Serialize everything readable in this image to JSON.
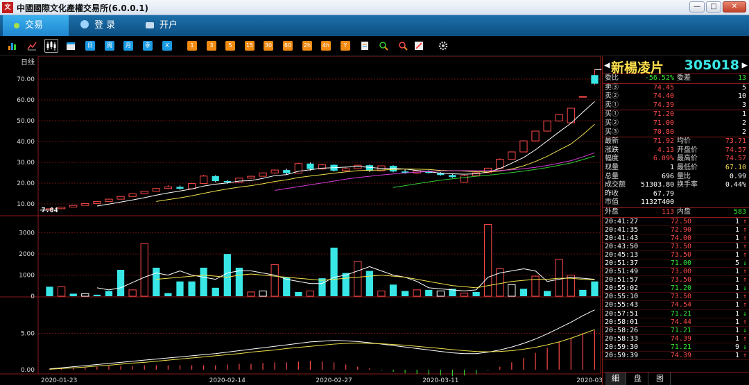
{
  "window": {
    "title": "中國國際文化產權交易所(6.0.0.1)",
    "logo_text": "文"
  },
  "nav": {
    "trade": "交易",
    "login": "登 录",
    "open_account": "开户"
  },
  "toolbar": {
    "icons": [
      "bar-chart-icon",
      "line-chart-icon",
      "kline-icon",
      "calendar-icon"
    ],
    "periods": [
      "日",
      "周",
      "月",
      "季",
      "X"
    ],
    "minutes": [
      "1",
      "3",
      "5",
      "15",
      "30",
      "60",
      "2h",
      "4h",
      "Y"
    ],
    "tools": [
      "report-icon",
      "zoom-in-icon",
      "zoom-out-icon",
      "draw-icon",
      "settings-icon"
    ]
  },
  "colors": {
    "up": "#ff4a4a",
    "down": "#38e6e6",
    "ma5": "#ffffff",
    "ma10": "#f0e24a",
    "ma20": "#d63cd6",
    "ma30": "#33cc33",
    "grid": "#8c1a1a",
    "axis_text": "#dddddd"
  },
  "chart_data": [
    {
      "type": "candlestick",
      "title": "日线",
      "dates": [
        "2020-01-23",
        "2020-01-24",
        "2020-01-28",
        "2020-01-29",
        "2020-01-30",
        "2020-01-31",
        "2020-02-03",
        "2020-02-04",
        "2020-02-05",
        "2020-02-06",
        "2020-02-07",
        "2020-02-10",
        "2020-02-11",
        "2020-02-12",
        "2020-02-13",
        "2020-02-14",
        "2020-02-17",
        "2020-02-18",
        "2020-02-19",
        "2020-02-20",
        "2020-02-21",
        "2020-02-24",
        "2020-02-25",
        "2020-02-26",
        "2020-02-27",
        "2020-02-28",
        "2020-03-02",
        "2020-03-03",
        "2020-03-04",
        "2020-03-05",
        "2020-03-06",
        "2020-03-09",
        "2020-03-10",
        "2020-03-11",
        "2020-03-12",
        "2020-03-13",
        "2020-03-16",
        "2020-03-17",
        "2020-03-18",
        "2020-03-19",
        "2020-03-20",
        "2020-03-23",
        "2020-03-24",
        "2020-03-25",
        "2020-03-26",
        "2020-03-27",
        "2020-03-30"
      ],
      "x_labels": [
        "2020-01-23",
        "2020-02-14",
        "2020-02-27",
        "2020-03-11",
        "2020-03-30"
      ],
      "ohlc": [
        [
          7.04,
          7.8,
          7.0,
          7.7
        ],
        [
          7.7,
          8.6,
          7.6,
          8.5
        ],
        [
          8.5,
          9.4,
          8.4,
          9.3
        ],
        [
          9.3,
          10.4,
          9.2,
          10.2
        ],
        [
          10.2,
          11.3,
          10.1,
          11.2
        ],
        [
          11.2,
          12.4,
          11.1,
          12.3
        ],
        [
          12.3,
          13.7,
          12.2,
          13.6
        ],
        [
          13.6,
          15.0,
          13.5,
          14.9
        ],
        [
          14.9,
          16.2,
          14.8,
          16.1
        ],
        [
          16.1,
          17.6,
          16.0,
          17.4
        ],
        [
          17.4,
          19.0,
          17.3,
          18.2
        ],
        [
          18.2,
          18.9,
          16.8,
          17.3
        ],
        [
          17.3,
          20.2,
          17.0,
          19.8
        ],
        [
          19.8,
          24.0,
          19.6,
          23.4
        ],
        [
          23.4,
          23.8,
          20.4,
          21.0
        ],
        [
          21.0,
          21.6,
          19.7,
          20.4
        ],
        [
          20.4,
          22.6,
          20.2,
          22.4
        ],
        [
          22.4,
          23.5,
          22.2,
          23.3
        ],
        [
          23.3,
          25.1,
          23.2,
          24.9
        ],
        [
          24.9,
          26.6,
          24.5,
          26.3
        ],
        [
          26.3,
          27.0,
          24.0,
          24.8
        ],
        [
          24.8,
          29.8,
          24.6,
          29.4
        ],
        [
          29.4,
          29.9,
          26.0,
          26.8
        ],
        [
          26.8,
          29.2,
          26.5,
          28.8
        ],
        [
          28.8,
          29.0,
          25.5,
          26.0
        ],
        [
          26.0,
          27.6,
          25.6,
          26.9
        ],
        [
          26.9,
          28.8,
          26.7,
          28.6
        ],
        [
          28.6,
          28.9,
          25.4,
          25.9
        ],
        [
          25.9,
          28.6,
          25.8,
          28.3
        ],
        [
          28.3,
          28.6,
          25.2,
          25.6
        ],
        [
          25.6,
          26.5,
          24.5,
          24.8
        ],
        [
          24.8,
          26.2,
          24.5,
          25.9
        ],
        [
          25.9,
          26.2,
          24.6,
          24.9
        ],
        [
          24.9,
          25.3,
          23.6,
          23.9
        ],
        [
          23.9,
          24.6,
          22.6,
          22.9
        ],
        [
          20.5,
          24.0,
          20.3,
          23.6
        ],
        [
          23.6,
          25.2,
          23.4,
          25.0
        ],
        [
          25.0,
          27.4,
          24.8,
          27.2
        ],
        [
          27.2,
          32.0,
          27.0,
          31.5
        ],
        [
          31.5,
          35.2,
          31.4,
          35.0
        ],
        [
          35.0,
          40.6,
          34.8,
          40.3
        ],
        [
          40.3,
          45.2,
          40.1,
          45.0
        ],
        [
          45.0,
          50.0,
          44.8,
          49.9
        ],
        [
          49.9,
          53.2,
          49.6,
          53.0
        ],
        [
          49.0,
          56.0,
          48.6,
          56.0
        ],
        [
          61.5,
          61.8,
          61.2,
          61.6
        ],
        [
          67.79,
          74.57,
          67.1,
          71.92
        ]
      ],
      "ma": {
        "MA5": [
          null,
          null,
          null,
          null,
          9.0,
          9.9,
          10.9,
          11.9,
          13.0,
          14.2,
          15.3,
          16.2,
          17.2,
          18.6,
          19.5,
          20.1,
          21.0,
          21.2,
          22.3,
          23.6,
          24.1,
          25.7,
          26.4,
          27.2,
          27.4,
          27.7,
          28.0,
          27.6,
          27.1,
          27.1,
          26.8,
          26.1,
          25.5,
          24.8,
          24.5,
          24.3,
          24.5,
          25.3,
          27.0,
          29.6,
          32.3,
          36.0,
          40.3,
          44.6,
          48.8,
          54.1,
          59.2
        ],
        "MA10": [
          null,
          null,
          null,
          null,
          null,
          null,
          null,
          null,
          null,
          11.2,
          12.1,
          12.9,
          13.9,
          15.1,
          16.2,
          17.2,
          18.1,
          18.8,
          19.7,
          20.8,
          21.6,
          22.7,
          23.4,
          24.1,
          24.8,
          25.4,
          26.0,
          26.2,
          26.3,
          26.6,
          26.8,
          26.7,
          26.6,
          26.1,
          25.9,
          25.8,
          25.5,
          25.4,
          25.8,
          26.8,
          28.3,
          30.4,
          32.9,
          35.9,
          38.8,
          43.3,
          48.3
        ],
        "MA20": [
          null,
          null,
          null,
          null,
          null,
          null,
          null,
          null,
          null,
          null,
          null,
          null,
          null,
          null,
          null,
          null,
          null,
          null,
          null,
          16.5,
          17.4,
          18.3,
          19.2,
          20.1,
          21.0,
          21.9,
          22.7,
          23.3,
          23.9,
          24.4,
          24.9,
          25.3,
          25.6,
          25.8,
          25.9,
          26.0,
          26.0,
          26.0,
          26.1,
          26.4,
          26.9,
          27.6,
          28.5,
          29.6,
          30.8,
          32.6,
          34.6
        ],
        "MA30": [
          null,
          null,
          null,
          null,
          null,
          null,
          null,
          null,
          null,
          null,
          null,
          null,
          null,
          null,
          null,
          null,
          null,
          null,
          null,
          null,
          null,
          null,
          null,
          null,
          null,
          null,
          null,
          null,
          null,
          17.9,
          18.8,
          19.7,
          20.6,
          21.4,
          22.1,
          22.7,
          23.3,
          23.8,
          24.4,
          25.1,
          25.8,
          26.6,
          27.5,
          28.6,
          29.7,
          31.3,
          33.0
        ]
      },
      "y_ticks": [
        10.0,
        20.0,
        30.0,
        40.0,
        50.0,
        60.0,
        70.0
      ],
      "ylim": [
        5,
        77
      ],
      "annotations": {
        "max_label": "74.57",
        "min_label": "7.04"
      }
    },
    {
      "type": "bar",
      "title": "volume",
      "values": [
        450,
        450,
        120,
        120,
        70,
        250,
        1250,
        300,
        2500,
        1350,
        150,
        700,
        700,
        1350,
        400,
        2000,
        1350,
        200,
        250,
        1500,
        900,
        200,
        250,
        850,
        2300,
        1100,
        1650,
        1200,
        250,
        550,
        250,
        300,
        300,
        250,
        350,
        150,
        200,
        3400,
        1300,
        550,
        350,
        950,
        250,
        1750,
        1000,
        300,
        700
      ],
      "up_flags": [
        false,
        true,
        false,
        true,
        false,
        false,
        false,
        true,
        true,
        false,
        false,
        false,
        false,
        false,
        false,
        false,
        false,
        true,
        true,
        true,
        false,
        false,
        true,
        false,
        false,
        false,
        true,
        false,
        true,
        false,
        false,
        true,
        false,
        true,
        false,
        true,
        false,
        true,
        true,
        true,
        false,
        true,
        false,
        true,
        true,
        false,
        false
      ],
      "ma_lines": {
        "white": [
          null,
          null,
          null,
          null,
          400,
          300,
          400,
          650,
          900,
          1100,
          1000,
          1200,
          1000,
          900,
          800,
          1100,
          1200,
          1200,
          1100,
          1000,
          800,
          700,
          600,
          600,
          900,
          1000,
          1200,
          1400,
          1200,
          1000,
          900,
          700,
          400,
          350,
          300,
          250,
          300,
          900,
          1100,
          1200,
          1300,
          1200,
          700,
          800,
          900,
          850,
          800
        ],
        "yellow": [
          null,
          null,
          null,
          null,
          null,
          null,
          null,
          null,
          null,
          800,
          850,
          900,
          950,
          1000,
          950,
          900,
          1000,
          1050,
          1000,
          950,
          900,
          850,
          800,
          750,
          800,
          850,
          900,
          950,
          1000,
          950,
          900,
          800,
          700,
          600,
          500,
          450,
          400,
          500,
          600,
          700,
          750,
          800,
          800,
          850,
          850,
          800,
          780
        ]
      },
      "y_ticks": [
        0,
        1000,
        2000,
        3000
      ],
      "ylim": [
        0,
        3550
      ]
    },
    {
      "type": "macd",
      "curves": {
        "white": [
          0.1,
          0.25,
          0.4,
          0.55,
          0.7,
          0.85,
          1.0,
          1.15,
          1.3,
          1.45,
          1.6,
          1.75,
          1.9,
          2.05,
          2.2,
          2.4,
          2.6,
          2.8,
          3.0,
          3.2,
          3.4,
          3.6,
          3.8,
          3.9,
          4.0,
          3.95,
          3.85,
          3.7,
          3.5,
          3.3,
          3.1,
          2.9,
          2.7,
          2.5,
          2.3,
          2.2,
          2.2,
          2.4,
          2.7,
          3.1,
          3.6,
          4.2,
          4.9,
          5.7,
          6.5,
          7.4,
          8.2
        ],
        "yellow": [
          0.05,
          0.15,
          0.25,
          0.35,
          0.5,
          0.6,
          0.75,
          0.9,
          1.0,
          1.15,
          1.3,
          1.45,
          1.6,
          1.75,
          1.9,
          2.05,
          2.2,
          2.4,
          2.55,
          2.7,
          2.9,
          3.05,
          3.2,
          3.35,
          3.5,
          3.6,
          3.65,
          3.6,
          3.55,
          3.45,
          3.35,
          3.2,
          3.05,
          2.9,
          2.75,
          2.6,
          2.5,
          2.45,
          2.5,
          2.6,
          2.8,
          3.05,
          3.4,
          3.8,
          4.3,
          4.9,
          5.5
        ]
      },
      "hist": [
        0.1,
        0.2,
        0.3,
        0.4,
        0.4,
        0.5,
        0.5,
        0.5,
        0.6,
        0.6,
        0.6,
        0.6,
        0.6,
        0.6,
        0.6,
        0.7,
        0.8,
        0.8,
        0.9,
        1.0,
        1.0,
        1.1,
        1.2,
        1.1,
        1.0,
        0.7,
        0.4,
        0.2,
        -0.1,
        -0.3,
        -0.5,
        -0.6,
        -0.7,
        -0.8,
        -0.9,
        -0.8,
        -0.6,
        -0.1,
        0.4,
        1.0,
        1.6,
        2.3,
        3.0,
        3.8,
        4.4,
        5.0,
        5.4
      ],
      "y_ticks": [
        0.0,
        5.0
      ],
      "ylim": [
        -0.3,
        9.5
      ]
    }
  ],
  "panel": {
    "name": "新楊凌片",
    "code": "305018",
    "webi_label": "委比",
    "webi_value": "-56.52%",
    "weicha_label": "委差",
    "weicha_value": "13",
    "sell": [
      {
        "label": "卖③",
        "price": "74.45",
        "vol": "5"
      },
      {
        "label": "卖②",
        "price": "74.40",
        "vol": "10"
      },
      {
        "label": "卖①",
        "price": "74.39",
        "vol": "3"
      }
    ],
    "buy": [
      {
        "label": "买①",
        "price": "71.20",
        "vol": "1"
      },
      {
        "label": "买②",
        "price": "71.00",
        "vol": "2"
      },
      {
        "label": "买③",
        "price": "70.80",
        "vol": "2"
      }
    ],
    "quote": [
      {
        "l1": "最新",
        "v1": "71.92",
        "c1": "red",
        "l2": "均价",
        "v2": "73.71",
        "c2": "red"
      },
      {
        "l1": "涨跌",
        "v1": "4.13",
        "c1": "red",
        "l2": "开盘价",
        "v2": "74.57",
        "c2": "red"
      },
      {
        "l1": "幅度",
        "v1": "6.09%",
        "c1": "red",
        "l2": "最高价",
        "v2": "74.57",
        "c2": "red"
      },
      {
        "l1": "现量",
        "v1": "1",
        "c1": "wht",
        "l2": "最低价",
        "v2": "67.10",
        "c2": "yel"
      },
      {
        "l1": "总量",
        "v1": "696",
        "c1": "wht",
        "l2": "量比",
        "v2": "0.99",
        "c2": "wht"
      },
      {
        "l1": "成交额",
        "v1": "51303.80",
        "c1": "wht",
        "l2": "换手率",
        "v2": "0.44%",
        "c2": "wht"
      },
      {
        "l1": "昨收",
        "v1": "67.79",
        "c1": "wht",
        "l2": "",
        "v2": "",
        "c2": "wht"
      },
      {
        "l1": "市值",
        "v1": "1132T400",
        "c1": "wht",
        "l2": "",
        "v2": "",
        "c2": "wht"
      }
    ],
    "outer_label": "外盘",
    "outer_value": "113",
    "inner_label": "内盘",
    "inner_value": "583",
    "ticks": [
      {
        "time": "20:41:27",
        "price": "72.50",
        "vol": "1",
        "dir": "up"
      },
      {
        "time": "20:41:35",
        "price": "72.90",
        "vol": "1",
        "dir": "up"
      },
      {
        "time": "20:41:43",
        "price": "74.00",
        "vol": "1",
        "dir": "up"
      },
      {
        "time": "20:43:50",
        "price": "73.50",
        "vol": "1",
        "dir": "up"
      },
      {
        "time": "20:45:13",
        "price": "73.50",
        "vol": "1",
        "dir": "up"
      },
      {
        "time": "20:51:37",
        "price": "71.00",
        "vol": "5",
        "dir": "down"
      },
      {
        "time": "20:51:49",
        "price": "73.00",
        "vol": "1",
        "dir": "up"
      },
      {
        "time": "20:51:57",
        "price": "73.50",
        "vol": "1",
        "dir": "up"
      },
      {
        "time": "20:55:02",
        "price": "71.20",
        "vol": "1",
        "dir": "down"
      },
      {
        "time": "20:55:10",
        "price": "73.50",
        "vol": "1",
        "dir": "up"
      },
      {
        "time": "20:55:43",
        "price": "74.54",
        "vol": "1",
        "dir": "up"
      },
      {
        "time": "20:57:51",
        "price": "71.21",
        "vol": "1",
        "dir": "down"
      },
      {
        "time": "20:58:01",
        "price": "74.44",
        "vol": "1",
        "dir": "up"
      },
      {
        "time": "20:58:26",
        "price": "71.21",
        "vol": "1",
        "dir": "down"
      },
      {
        "time": "20:58:33",
        "price": "74.39",
        "vol": "1",
        "dir": "up"
      },
      {
        "time": "20:59:30",
        "price": "71.21",
        "vol": "9",
        "dir": "down"
      },
      {
        "time": "20:59:39",
        "price": "74.39",
        "vol": "1",
        "dir": "up"
      }
    ],
    "tabs": [
      "細",
      "盘",
      "图"
    ]
  }
}
